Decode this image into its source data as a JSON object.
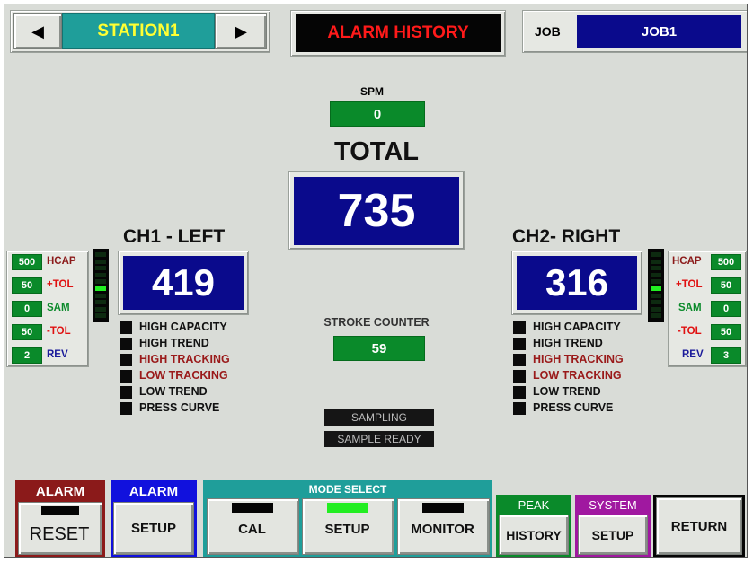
{
  "header": {
    "station": "STATION1",
    "title": "ALARM HISTORY",
    "job_label": "JOB",
    "job_value": "JOB1"
  },
  "spm": {
    "label": "SPM",
    "value": "0"
  },
  "total": {
    "label": "TOTAL",
    "value": "735"
  },
  "ch1": {
    "title": "CH1 - LEFT",
    "value": "419",
    "params": [
      {
        "value": "500",
        "label": "HCAP",
        "color": "#8b1a1a"
      },
      {
        "value": "50",
        "label": "+TOL",
        "color": "#e01010"
      },
      {
        "value": "0",
        "label": "SAM",
        "color": "#0a8a2a"
      },
      {
        "value": "50",
        "label": "-TOL",
        "color": "#e01010"
      },
      {
        "value": "2",
        "label": "REV",
        "color": "#1a1a9a"
      }
    ],
    "statuses": [
      {
        "label": "HIGH CAPACITY",
        "color": "#111111"
      },
      {
        "label": "HIGH TREND",
        "color": "#111111"
      },
      {
        "label": "HIGH TRACKING",
        "color": "#9a1a1a"
      },
      {
        "label": "LOW TRACKING",
        "color": "#9a1a1a"
      },
      {
        "label": "LOW TREND",
        "color": "#111111"
      },
      {
        "label": "PRESS CURVE",
        "color": "#111111"
      }
    ],
    "bar_level": 0.5
  },
  "ch2": {
    "title": "CH2- RIGHT",
    "value": "316",
    "params": [
      {
        "value": "500",
        "label": "HCAP",
        "color": "#8b1a1a"
      },
      {
        "value": "50",
        "label": "+TOL",
        "color": "#e01010"
      },
      {
        "value": "0",
        "label": "SAM",
        "color": "#0a8a2a"
      },
      {
        "value": "50",
        "label": "-TOL",
        "color": "#e01010"
      },
      {
        "value": "3",
        "label": "REV",
        "color": "#1a1a9a"
      }
    ],
    "statuses": [
      {
        "label": "HIGH CAPACITY",
        "color": "#111111"
      },
      {
        "label": "HIGH TREND",
        "color": "#111111"
      },
      {
        "label": "HIGH TRACKING",
        "color": "#9a1a1a"
      },
      {
        "label": "LOW TRACKING",
        "color": "#9a1a1a"
      },
      {
        "label": "LOW TREND",
        "color": "#111111"
      },
      {
        "label": "PRESS CURVE",
        "color": "#111111"
      }
    ],
    "bar_level": 0.5
  },
  "stroke_counter": {
    "label": "STROKE COUNTER",
    "value": "59"
  },
  "indicators": {
    "sampling": "SAMPLING",
    "sample_ready": "SAMPLE READY"
  },
  "footer": {
    "alarm_reset_header": "ALARM",
    "alarm_reset_button": "RESET",
    "alarm_setup_header": "ALARM",
    "alarm_setup_button": "SETUP",
    "mode_select_header": "MODE SELECT",
    "mode_cal": "CAL",
    "mode_setup": "SETUP",
    "mode_monitor": "MONITOR",
    "peak_header": "PEAK",
    "peak_button": "HISTORY",
    "system_header": "SYSTEM",
    "system_button": "SETUP",
    "return_button": "RETURN"
  },
  "colors": {
    "navy": "#0a0a8c",
    "green": "#0a8a2a",
    "teal": "#1f9e9a",
    "station_text": "#ffff33",
    "alarm_title": "#ff1a1a",
    "led_on": "#22ee22",
    "led_off": "#0b0b0b"
  }
}
